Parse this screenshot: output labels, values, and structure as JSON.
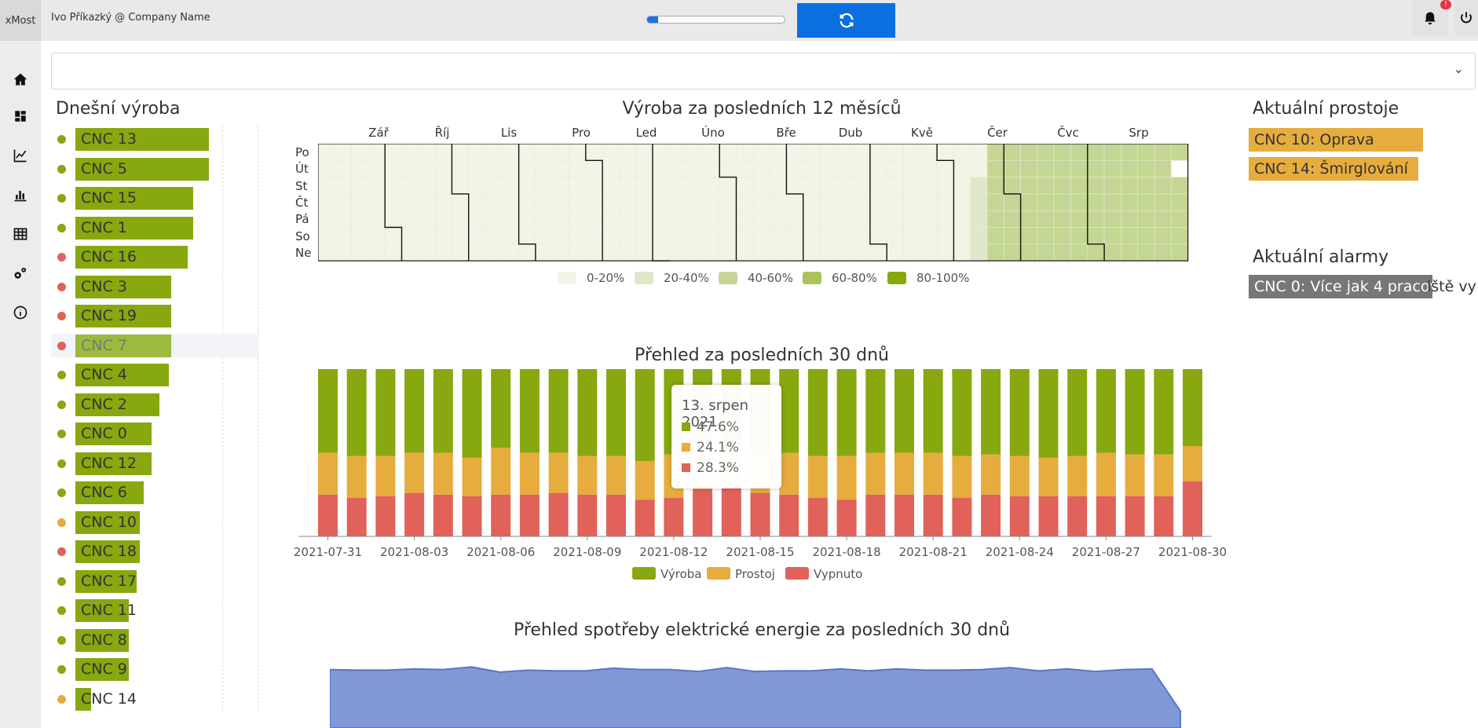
{
  "header": {
    "brand": "xMost",
    "user": "Ivo Příkazký @ Company Name",
    "progress": 0.08,
    "refresh_icon": "refresh-icon",
    "bell_icon": "bell-icon",
    "bell_badge": "!",
    "power_icon": "power-icon"
  },
  "nav": [
    "home-icon",
    "dashboard-icon",
    "line-chart-icon",
    "bar-chart-icon",
    "table-icon",
    "settings-icon",
    "info-icon"
  ],
  "select": {
    "value": ""
  },
  "today": {
    "title": "Dnešní výroba",
    "items": [
      {
        "name": "CNC 13",
        "value": 1.0,
        "status": "ok"
      },
      {
        "name": "CNC 5",
        "value": 1.0,
        "status": "ok"
      },
      {
        "name": "CNC 15",
        "value": 0.88,
        "status": "ok"
      },
      {
        "name": "CNC 1",
        "value": 0.88,
        "status": "ok"
      },
      {
        "name": "CNC 16",
        "value": 0.84,
        "status": "off"
      },
      {
        "name": "CNC 3",
        "value": 0.72,
        "status": "off"
      },
      {
        "name": "CNC 19",
        "value": 0.72,
        "status": "off"
      },
      {
        "name": "CNC 7",
        "value": 0.72,
        "status": "off"
      },
      {
        "name": "CNC 4",
        "value": 0.7,
        "status": "ok"
      },
      {
        "name": "CNC 2",
        "value": 0.63,
        "status": "ok"
      },
      {
        "name": "CNC 0",
        "value": 0.57,
        "status": "ok"
      },
      {
        "name": "CNC 12",
        "value": 0.57,
        "status": "ok"
      },
      {
        "name": "CNC 6",
        "value": 0.51,
        "status": "ok"
      },
      {
        "name": "CNC 10",
        "value": 0.48,
        "status": "idle"
      },
      {
        "name": "CNC 18",
        "value": 0.48,
        "status": "off"
      },
      {
        "name": "CNC 17",
        "value": 0.46,
        "status": "ok"
      },
      {
        "name": "CNC 11",
        "value": 0.4,
        "status": "ok"
      },
      {
        "name": "CNC 8",
        "value": 0.4,
        "status": "ok"
      },
      {
        "name": "CNC 9",
        "value": 0.4,
        "status": "ok"
      },
      {
        "name": "CNC 14",
        "value": 0.12,
        "status": "idle"
      }
    ]
  },
  "colors": {
    "ok": "#87a80f",
    "idle": "#e6ac3d",
    "off": "#e0625a",
    "accent": "#0b6fe0",
    "energy": "#8098d6"
  },
  "heatmap": {
    "title": "Výroba za posledních 12 měsíců",
    "months": [
      "Zář",
      "Říj",
      "Lis",
      "Pro",
      "Led",
      "Úno",
      "Bře",
      "Dub",
      "Kvě",
      "Čer",
      "Čvc",
      "Srp"
    ],
    "days": [
      "Po",
      "Út",
      "St",
      "Čt",
      "Pá",
      "So",
      "Ne"
    ],
    "legend": [
      "0-20%",
      "20-40%",
      "40-60%",
      "60-80%",
      "80-100%"
    ],
    "legend_colors": [
      "#f2f5e6",
      "#dfe8c8",
      "#c4d694",
      "#a9c45b",
      "#87a80f"
    ]
  },
  "chart_data": [
    {
      "type": "bar",
      "title": "Přehled za posledních 30 dnů",
      "x": [
        "2021-07-31",
        "2021-08-01",
        "2021-08-02",
        "2021-08-03",
        "2021-08-04",
        "2021-08-05",
        "2021-08-06",
        "2021-08-07",
        "2021-08-08",
        "2021-08-09",
        "2021-08-10",
        "2021-08-11",
        "2021-08-12",
        "2021-08-13",
        "2021-08-14",
        "2021-08-15",
        "2021-08-16",
        "2021-08-17",
        "2021-08-18",
        "2021-08-19",
        "2021-08-20",
        "2021-08-21",
        "2021-08-22",
        "2021-08-23",
        "2021-08-24",
        "2021-08-25",
        "2021-08-26",
        "2021-08-27",
        "2021-08-28",
        "2021-08-29",
        "2021-08-30"
      ],
      "tick_labels": [
        "2021-07-31",
        "2021-08-03",
        "2021-08-06",
        "2021-08-09",
        "2021-08-12",
        "2021-08-15",
        "2021-08-18",
        "2021-08-21",
        "2021-08-24",
        "2021-08-27",
        "2021-08-30"
      ],
      "stacked": true,
      "series": [
        {
          "name": "Výroba",
          "color": "#87a80f",
          "values": [
            50,
            52,
            52,
            50,
            50,
            53,
            47,
            50,
            50,
            52,
            52,
            55,
            51,
            47.6,
            47,
            49,
            50,
            52,
            52,
            50,
            50,
            50,
            52,
            51,
            52,
            53,
            52,
            50,
            51,
            51,
            46
          ]
        },
        {
          "name": "Prostoj",
          "color": "#e6ac3d",
          "values": [
            25,
            25,
            24,
            24,
            25,
            23,
            28,
            25,
            24,
            23,
            23,
            23,
            26,
            24.1,
            24,
            25,
            25,
            25,
            26,
            25,
            25,
            25,
            25,
            24,
            24,
            23,
            24,
            26,
            25,
            25,
            21
          ]
        },
        {
          "name": "Vypnuto",
          "color": "#e0625a",
          "values": [
            25,
            23,
            24,
            26,
            25,
            24,
            25,
            25,
            26,
            25,
            25,
            22,
            23,
            28.3,
            29,
            26,
            25,
            23,
            22,
            25,
            25,
            25,
            23,
            25,
            24,
            24,
            24,
            24,
            24,
            24,
            33
          ]
        }
      ],
      "ylim": [
        0,
        100
      ],
      "tooltip": {
        "title": "13. srpen 2021",
        "rows": [
          "47.6%",
          "24.1%",
          "28.3%"
        ]
      }
    },
    {
      "type": "area",
      "title": "Přehled spotřeby elektrické energie za posledních 30 dnů",
      "values": [
        84,
        83,
        83,
        85,
        84,
        88,
        80,
        83,
        82,
        82,
        86,
        84,
        84,
        81,
        87,
        81,
        82,
        82,
        85,
        82,
        85,
        83,
        83,
        84,
        87,
        82,
        85,
        81,
        84,
        85,
        20
      ],
      "ylim": [
        0,
        100
      ]
    }
  ],
  "downtime": {
    "title": "Aktuální prostoje",
    "items": [
      "CNC 10: Oprava",
      "CNC 14: Šmirglování"
    ]
  },
  "alarms": {
    "title": "Aktuální alarmy",
    "text": "CNC 0: Více jak 4 pracov",
    "overflow": "iště vy"
  }
}
